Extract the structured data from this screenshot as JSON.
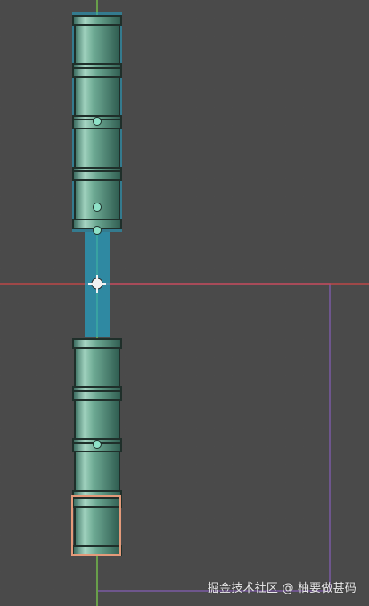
{
  "watermark": "掘金技术社区 @ 柚要做甚码",
  "colors": {
    "background": "#4a4a4a",
    "pipe_body": "#5f9a84",
    "pipe_highlight": "#9fd1bd",
    "pipe_dark": "#2f5c50",
    "pipe_outline": "#1f2f2a",
    "selection_cyan": "#23a4c8",
    "axis_red": "#d24747",
    "axis_green": "#7dd54a",
    "purple": "#7b5aa3",
    "highlight_orange": "#e49a7a"
  },
  "icons": {
    "pivot": "move-gizmo-icon",
    "anchor": "anchor-handle-icon"
  }
}
